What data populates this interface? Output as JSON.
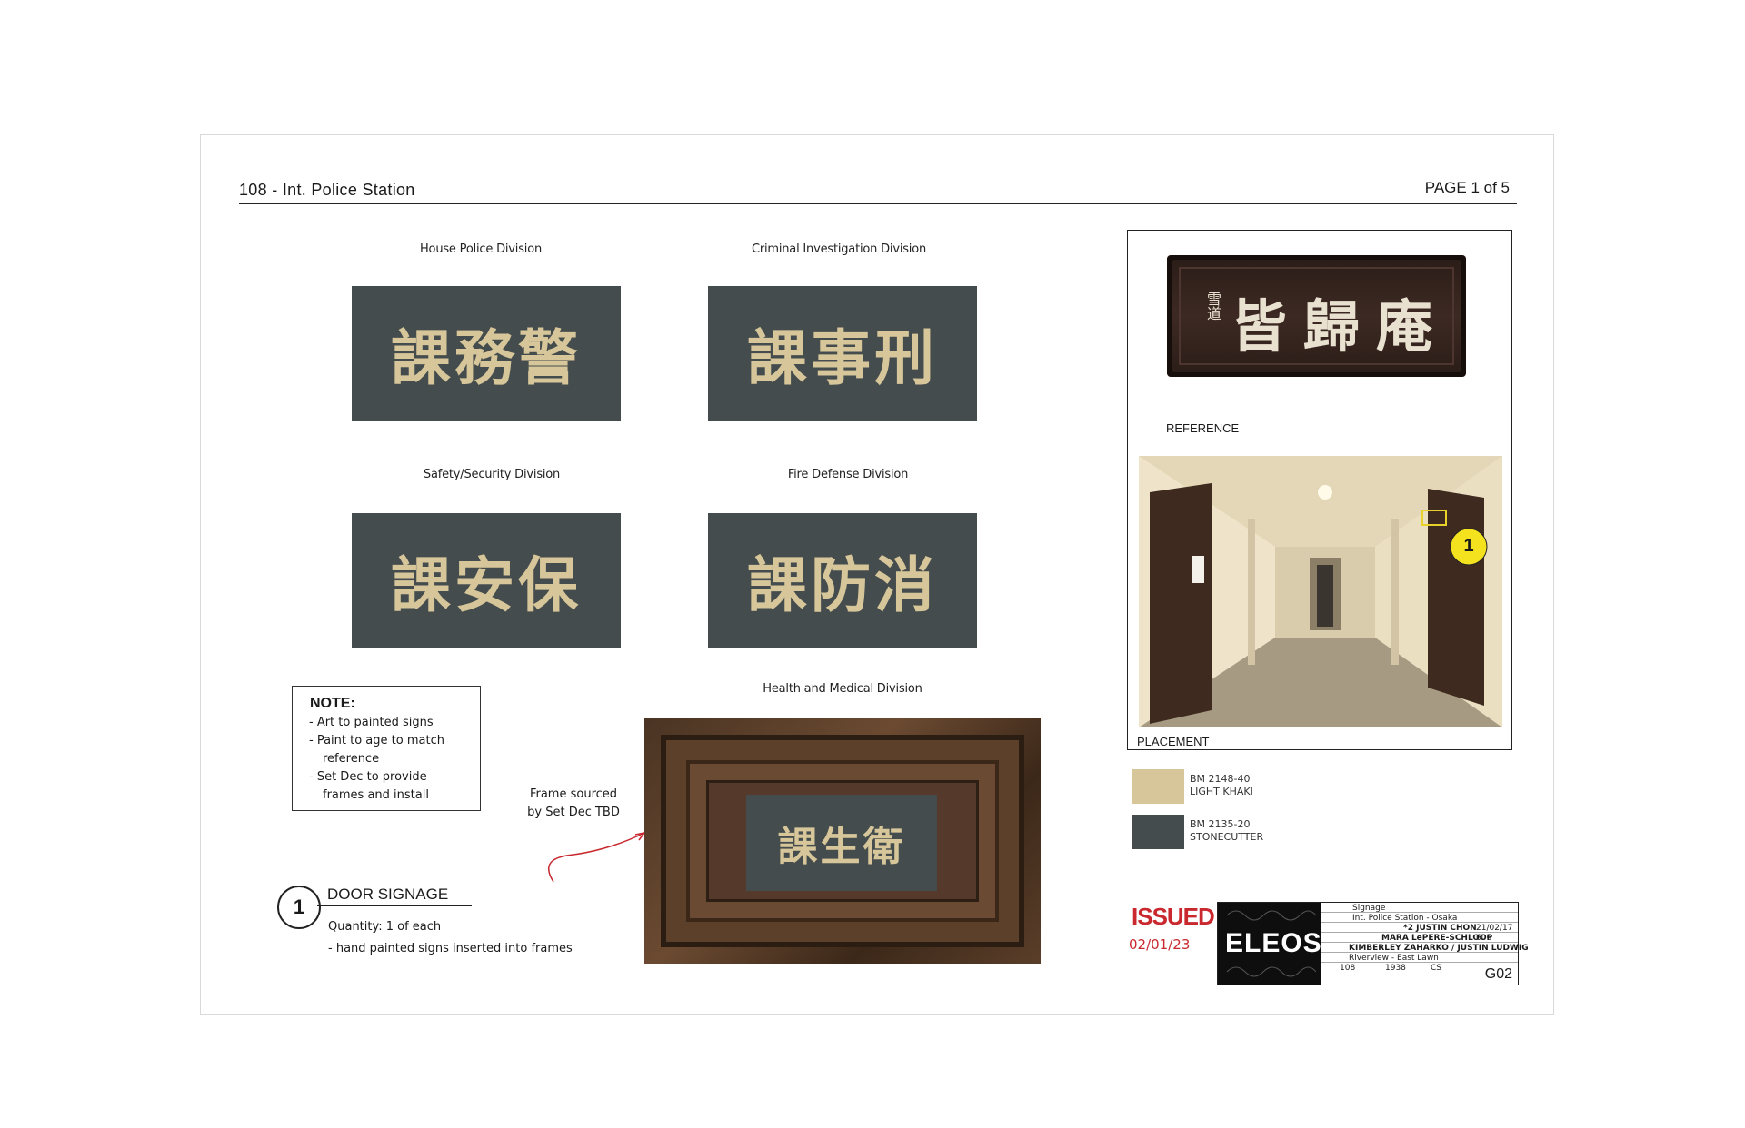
{
  "header": {
    "title": "108 - Int. Police Station",
    "page": "PAGE 1 of 5"
  },
  "signs": [
    {
      "caption": "House Police Division",
      "text": "課務警"
    },
    {
      "caption": "Criminal Investigation Division",
      "text": "課事刑"
    },
    {
      "caption": "Safety/Security Division",
      "text": "課安保"
    },
    {
      "caption": "Fire Defense Division",
      "text": "課防消"
    }
  ],
  "health": {
    "caption": "Health and Medical Division",
    "text": "課生衛"
  },
  "note": {
    "title": "NOTE:",
    "line1": "- Art to painted signs",
    "line2": "- Paint to age to match",
    "line2b": "reference",
    "line3": "- Set Dec to provide",
    "line3b": "frames and install"
  },
  "frame_label": {
    "line1": "Frame sourced",
    "line2": "by Set Dec TBD"
  },
  "door": {
    "number": "1",
    "title": "DOOR SIGNAGE",
    "quantity": "Quantity: 1 of each",
    "desc": "- hand painted signs inserted into frames"
  },
  "reference": {
    "label": "REFERENCE",
    "board_text": "皆歸庵",
    "board_small": "雪道",
    "placement_label": "PLACEMENT",
    "marker": "1"
  },
  "swatches": [
    {
      "code": "BM 2148-40",
      "name": "LIGHT KHAKI",
      "color": "#d6c69a"
    },
    {
      "code": "BM 2135-20",
      "name": "STONECUTTER",
      "color": "#454c4d"
    }
  ],
  "issued": {
    "label": "ISSUED",
    "date": "02/01/23",
    "color": "#c8282e"
  },
  "title_block": {
    "logo": "ELEOS",
    "title": "Signage",
    "set": "Int. Police Station - Osaka",
    "director": "*2 JUSTIN CHON",
    "date": "21/02/17",
    "designer": "MARA LePERE-SCHLOOP",
    "set_no": "606",
    "art_director": "KIMBERLEY ZAHARKO / JUSTIN LUDWIG",
    "location": "Riverview - East Lawn",
    "episode": "108",
    "year": "1938",
    "drawn_by": "CS",
    "sheet": "G02"
  }
}
